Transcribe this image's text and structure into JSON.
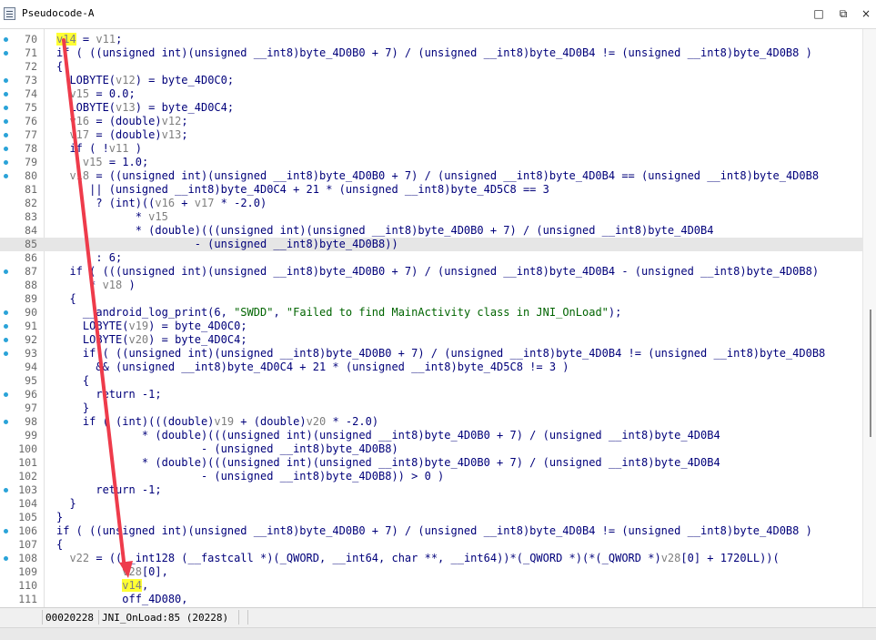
{
  "window": {
    "title": "Pseudocode-A",
    "buttons": {
      "maximize": "□",
      "restore": "⧉",
      "close": "×"
    }
  },
  "editor": {
    "lines": [
      {
        "num": "70",
        "dot": true,
        "hl": false,
        "text": "v14 = v11;"
      },
      {
        "num": "71",
        "dot": true,
        "hl": false,
        "text": "if ( ((unsigned int)(unsigned __int8)byte_4D0B0 + 7) / (unsigned __int8)byte_4D0B4 != (unsigned __int8)byte_4D0B8 )"
      },
      {
        "num": "72",
        "dot": false,
        "hl": false,
        "text": "{"
      },
      {
        "num": "73",
        "dot": true,
        "hl": false,
        "text": "  LOBYTE(v12) = byte_4D0C0;"
      },
      {
        "num": "74",
        "dot": true,
        "hl": false,
        "text": "  v15 = 0.0;"
      },
      {
        "num": "75",
        "dot": true,
        "hl": false,
        "text": "  LOBYTE(v13) = byte_4D0C4;"
      },
      {
        "num": "76",
        "dot": true,
        "hl": false,
        "text": "  v16 = (double)v12;"
      },
      {
        "num": "77",
        "dot": true,
        "hl": false,
        "text": "  v17 = (double)v13;"
      },
      {
        "num": "78",
        "dot": true,
        "hl": false,
        "text": "  if ( !v11 )"
      },
      {
        "num": "79",
        "dot": true,
        "hl": false,
        "text": "    v15 = 1.0;"
      },
      {
        "num": "80",
        "dot": true,
        "hl": false,
        "text": "  v18 = ((unsigned int)(unsigned __int8)byte_4D0B0 + 7) / (unsigned __int8)byte_4D0B4 == (unsigned __int8)byte_4D0B8"
      },
      {
        "num": "81",
        "dot": false,
        "hl": false,
        "text": "     || (unsigned __int8)byte_4D0C4 + 21 * (unsigned __int8)byte_4D5C8 == 3"
      },
      {
        "num": "82",
        "dot": false,
        "hl": false,
        "text": "      ? (int)((v16 + v17 * -2.0)"
      },
      {
        "num": "83",
        "dot": false,
        "hl": false,
        "text": "            * v15"
      },
      {
        "num": "84",
        "dot": false,
        "hl": false,
        "text": "            * (double)(((unsigned int)(unsigned __int8)byte_4D0B0 + 7) / (unsigned __int8)byte_4D0B4"
      },
      {
        "num": "85",
        "dot": false,
        "hl": true,
        "text": "                     - (unsigned __int8)byte_4D0B8))"
      },
      {
        "num": "86",
        "dot": false,
        "hl": false,
        "text": "      : 6;"
      },
      {
        "num": "87",
        "dot": true,
        "hl": false,
        "text": "  if ( (((unsigned int)(unsigned __int8)byte_4D0B0 + 7) / (unsigned __int8)byte_4D0B4 - (unsigned __int8)byte_4D0B8)"
      },
      {
        "num": "88",
        "dot": false,
        "hl": false,
        "text": "     * v18 )"
      },
      {
        "num": "89",
        "dot": false,
        "hl": false,
        "text": "  {"
      },
      {
        "num": "90",
        "dot": true,
        "hl": false,
        "text": "    __android_log_print(6, \"SWDD\", \"Failed to find MainActivity class in JNI_OnLoad\");"
      },
      {
        "num": "91",
        "dot": true,
        "hl": false,
        "text": "    LOBYTE(v19) = byte_4D0C0;"
      },
      {
        "num": "92",
        "dot": true,
        "hl": false,
        "text": "    LOBYTE(v20) = byte_4D0C4;"
      },
      {
        "num": "93",
        "dot": true,
        "hl": false,
        "text": "    if ( ((unsigned int)(unsigned __int8)byte_4D0B0 + 7) / (unsigned __int8)byte_4D0B4 != (unsigned __int8)byte_4D0B8"
      },
      {
        "num": "94",
        "dot": false,
        "hl": false,
        "text": "      && (unsigned __int8)byte_4D0C4 + 21 * (unsigned __int8)byte_4D5C8 != 3 )"
      },
      {
        "num": "95",
        "dot": false,
        "hl": false,
        "text": "    {"
      },
      {
        "num": "96",
        "dot": true,
        "hl": false,
        "text": "      return -1;"
      },
      {
        "num": "97",
        "dot": false,
        "hl": false,
        "text": "    }"
      },
      {
        "num": "98",
        "dot": true,
        "hl": false,
        "text": "    if ( (int)(((double)v19 + (double)v20 * -2.0)"
      },
      {
        "num": "99",
        "dot": false,
        "hl": false,
        "text": "             * (double)(((unsigned int)(unsigned __int8)byte_4D0B0 + 7) / (unsigned __int8)byte_4D0B4"
      },
      {
        "num": "100",
        "dot": false,
        "hl": false,
        "text": "                      - (unsigned __int8)byte_4D0B8)"
      },
      {
        "num": "101",
        "dot": false,
        "hl": false,
        "text": "             * (double)(((unsigned int)(unsigned __int8)byte_4D0B0 + 7) / (unsigned __int8)byte_4D0B4"
      },
      {
        "num": "102",
        "dot": false,
        "hl": false,
        "text": "                      - (unsigned __int8)byte_4D0B8)) > 0 )"
      },
      {
        "num": "103",
        "dot": true,
        "hl": false,
        "text": "      return -1;"
      },
      {
        "num": "104",
        "dot": false,
        "hl": false,
        "text": "  }"
      },
      {
        "num": "105",
        "dot": false,
        "hl": false,
        "text": "}"
      },
      {
        "num": "106",
        "dot": true,
        "hl": false,
        "text": "if ( ((unsigned int)(unsigned __int8)byte_4D0B0 + 7) / (unsigned __int8)byte_4D0B4 != (unsigned __int8)byte_4D0B8 )"
      },
      {
        "num": "107",
        "dot": false,
        "hl": false,
        "text": "{"
      },
      {
        "num": "108",
        "dot": true,
        "hl": false,
        "text": "  v22 = ((__int128 (__fastcall *)(_QWORD, __int64, char **, __int64))*(_QWORD *)(*(_QWORD *)v28[0] + 1720LL))("
      },
      {
        "num": "109",
        "dot": false,
        "hl": false,
        "text": "          v28[0],"
      },
      {
        "num": "110",
        "dot": false,
        "hl": false,
        "text": "          v14,"
      },
      {
        "num": "111",
        "dot": false,
        "hl": false,
        "text": "          off_4D080,"
      }
    ]
  },
  "status": {
    "address": "00020228",
    "location": "JNI_OnLoad:85 (20228)"
  },
  "colors": {
    "keyword": "#00007a",
    "variable": "#7f7f7f",
    "string": "#006400",
    "highlight": "#ffff33",
    "dot": "#2aa3d8",
    "arrow": "#ee3b4b"
  }
}
